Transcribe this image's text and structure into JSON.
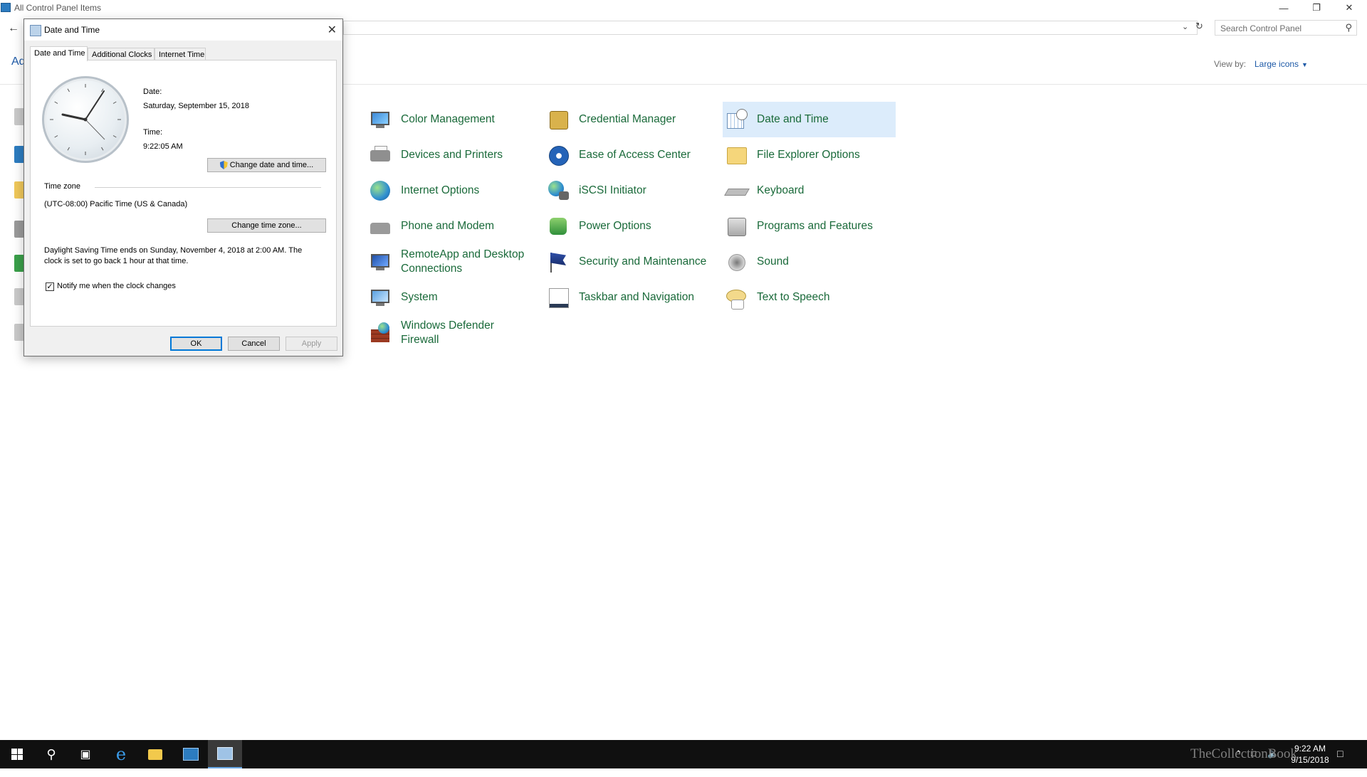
{
  "window": {
    "title": "All Control Panel Items"
  },
  "search": {
    "placeholder": "Search Control Panel"
  },
  "header": {
    "adjust_text": "Ad",
    "view_by_label": "View by:",
    "view_by_value": "Large icons"
  },
  "items": [
    {
      "label": "Color Management",
      "icon": "color-management-icon"
    },
    {
      "label": "Credential Manager",
      "icon": "credential-manager-icon"
    },
    {
      "label": "Date and Time",
      "icon": "date-time-icon"
    },
    {
      "label": "Devices and Printers",
      "icon": "printer-icon"
    },
    {
      "label": "Ease of Access Center",
      "icon": "ease-of-access-icon"
    },
    {
      "label": "File Explorer Options",
      "icon": "folder-options-icon"
    },
    {
      "label": "Internet Options",
      "icon": "internet-options-icon"
    },
    {
      "label": "iSCSI Initiator",
      "icon": "iscsi-icon"
    },
    {
      "label": "Keyboard",
      "icon": "keyboard-icon"
    },
    {
      "label": "Phone and Modem",
      "icon": "phone-modem-icon"
    },
    {
      "label": "Power Options",
      "icon": "power-options-icon"
    },
    {
      "label": "Programs and Features",
      "icon": "programs-features-icon"
    },
    {
      "label": "RemoteApp and Desktop",
      "label2": "Connections",
      "icon": "remoteapp-icon"
    },
    {
      "label": "Security and Maintenance",
      "icon": "security-flag-icon"
    },
    {
      "label": "Sound",
      "icon": "sound-icon"
    },
    {
      "label": "System",
      "icon": "system-icon"
    },
    {
      "label": "Taskbar and Navigation",
      "icon": "taskbar-icon"
    },
    {
      "label": "Text to Speech",
      "icon": "speech-icon"
    },
    {
      "label": "Windows Defender",
      "label2": "Firewall",
      "icon": "firewall-icon"
    }
  ],
  "dialog": {
    "title": "Date and Time",
    "tabs": [
      "Date and Time",
      "Additional Clocks",
      "Internet Time"
    ],
    "date_label": "Date:",
    "date_value": "Saturday, September 15, 2018",
    "time_label": "Time:",
    "time_value": "9:22:05 AM",
    "change_datetime_button": "Change date and time...",
    "timezone_heading": "Time zone",
    "timezone_value": "(UTC-08:00) Pacific Time (US & Canada)",
    "change_timezone_button": "Change time zone...",
    "dst_line1": "Daylight Saving Time ends on Sunday, November 4, 2018 at 2:00 AM. The",
    "dst_line2": "clock is set to go back 1 hour at that time.",
    "notify_label": "Notify me when the clock changes",
    "notify_checked": true,
    "ok": "OK",
    "cancel": "Cancel",
    "apply": "Apply"
  },
  "taskbar": {
    "clock_time": "9:22 AM",
    "clock_date": "9/15/2018",
    "watermark": "TheCollectionBook"
  },
  "colors": {
    "link_green": "#1a6a3a",
    "link_blue": "#1e5aa7",
    "selection": "#dcecfb",
    "taskbar": "#101010"
  }
}
